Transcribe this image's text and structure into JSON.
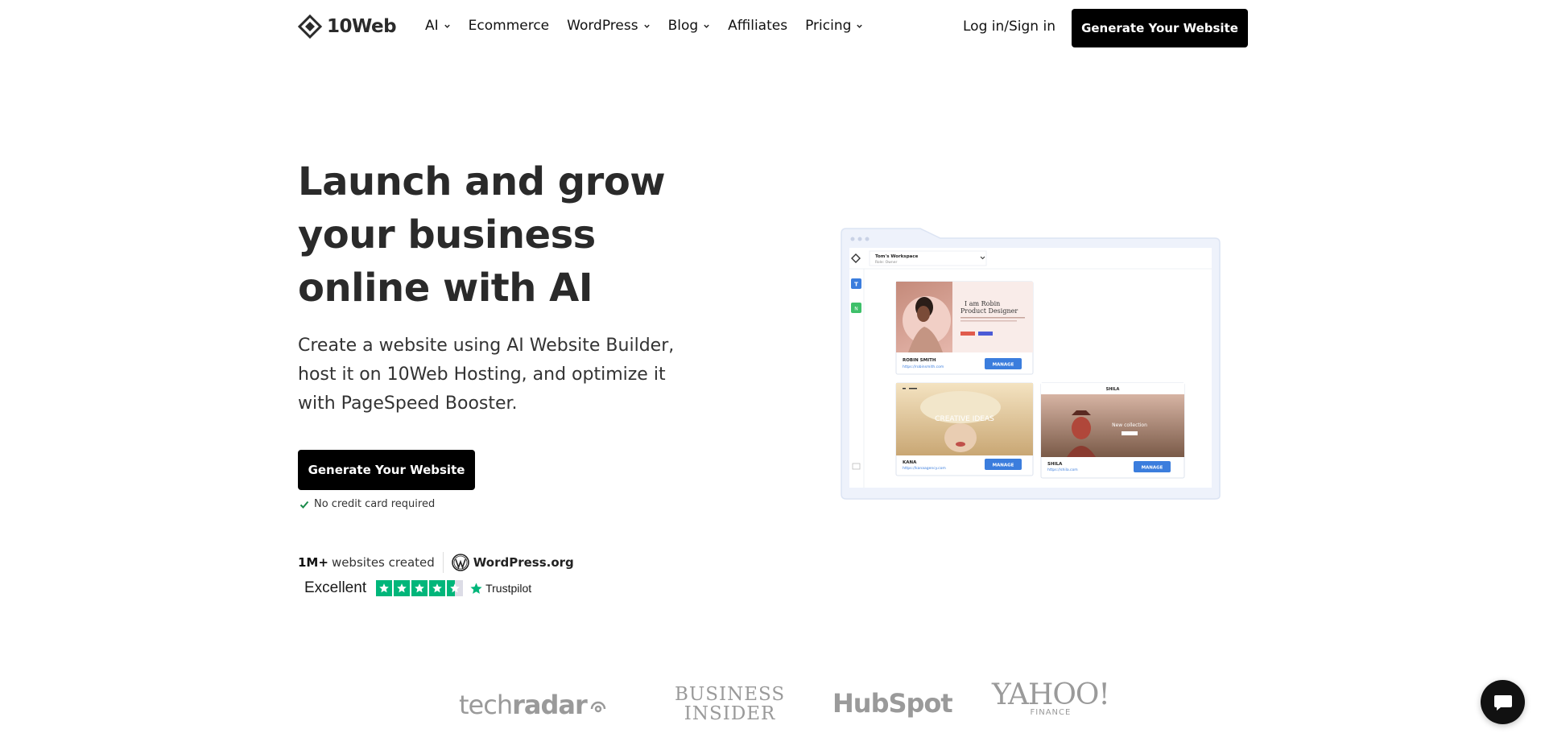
{
  "header": {
    "brand": "10Web",
    "nav": [
      {
        "label": "AI",
        "has_dropdown": true
      },
      {
        "label": "Ecommerce",
        "has_dropdown": false
      },
      {
        "label": "WordPress",
        "has_dropdown": true
      },
      {
        "label": "Blog",
        "has_dropdown": true
      },
      {
        "label": "Affiliates",
        "has_dropdown": false
      },
      {
        "label": "Pricing",
        "has_dropdown": true
      }
    ],
    "login_label": "Log in/Sign in",
    "cta_label": "Generate Your Website"
  },
  "hero": {
    "title_lines": [
      "Launch and grow",
      "your business",
      "online with AI"
    ],
    "subtitle": "Create a website using AI Website Builder, host it on 10Web Hosting, and optimize it with PageSpeed Booster.",
    "cta_label": "Generate Your Website",
    "note": "No credit card required",
    "stats_count": "1M+",
    "stats_text": "websites created",
    "partner": "WordPress.org",
    "trust_rating": "Excellent",
    "trust_brand": "Trustpilot",
    "trust_stars": 4.5
  },
  "illustration": {
    "workspace_name": "Tom's Workspace",
    "workspace_role": "Role: Owner",
    "card1": {
      "title_line1": "I am Robin",
      "title_line2": "Product Designer",
      "name": "ROBIN SMITH",
      "url": "https://robinsmith.com",
      "button": "MANAGE"
    },
    "card2": {
      "hero_text": "CREATIVE IDEAS",
      "name": "KANA",
      "url": "https://kanaagency.com",
      "button": "MANAGE"
    },
    "card3": {
      "brand": "SHILA",
      "hero_text": "New collection",
      "name": "SHILA",
      "url": "https://shila.com",
      "button": "MANAGE"
    }
  },
  "press": {
    "techradar_a": "tech",
    "techradar_b": "radar",
    "bi_line1": "BUSINESS",
    "bi_line2": "INSIDER",
    "hubspot": "HubSpot",
    "yahoo": "YAHOO!",
    "yahoo_sub": "FINANCE"
  },
  "colors": {
    "cta_bg": "#000000",
    "trustpilot_green": "#00b67a",
    "manage_blue": "#3b7ddd"
  }
}
